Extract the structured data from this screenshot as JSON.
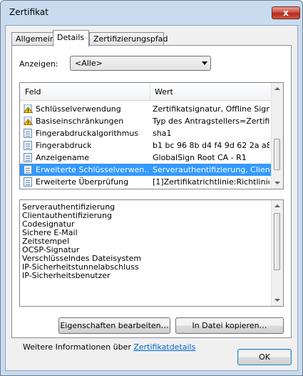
{
  "window": {
    "title": "Zertifikat",
    "close_glyph": "x"
  },
  "tabs": [
    {
      "label": "Allgemein",
      "active": false
    },
    {
      "label": "Details",
      "active": true
    },
    {
      "label": "Zertifizierungspfad",
      "active": false
    }
  ],
  "show": {
    "label": "Anzeigen:",
    "value": "<Alle>"
  },
  "fields_list": {
    "columns": {
      "field": "Feld",
      "value": "Wert"
    },
    "rows": [
      {
        "icon": "warning-certificate-icon",
        "field": "Schlüsselverwendung",
        "value": "Zertifikatsignatur, Offline Signi…"
      },
      {
        "icon": "warning-certificate-icon",
        "field": "Basiseinschränkungen",
        "value": "Typ des Antragstellers=Zertifi…"
      },
      {
        "icon": "certificate-field-icon",
        "field": "Fingerabdruckalgorithmus",
        "value": "sha1"
      },
      {
        "icon": "certificate-field-icon",
        "field": "Fingerabdruck",
        "value": "b1 bc 96 8b d4 f4 9d 62 2a a8 …"
      },
      {
        "icon": "certificate-field-icon",
        "field": "Anzeigename",
        "value": "GlobalSign Root CA - R1"
      },
      {
        "icon": "certificate-field-icon",
        "field": "Erweiterte Schlüsselverwen…",
        "value": "Serverauthentifizierung, Client…",
        "selected": true
      },
      {
        "icon": "certificate-field-icon",
        "field": "Erweiterte Überprüfung",
        "value": "[1]Zertifikatrichtlinie:Richtlinie…"
      }
    ]
  },
  "detail_text": {
    "lines": [
      "Serverauthentifizierung",
      "Clientauthentifizierung",
      "Codesignatur",
      "Sichere E-Mail",
      "Zeitstempel",
      "OCSP-Signatur",
      "Verschlüsselndes Dateisystem",
      "IP-Sicherheitstunnelabschluss",
      "IP-Sicherheitsbenutzer"
    ]
  },
  "buttons": {
    "edit_properties": "Eigenschaften bearbeiten…",
    "copy_to_file": "In Datei kopieren…",
    "ok": "OK"
  },
  "info": {
    "text": "Weitere Informationen über ",
    "link": "Zertifikatdetails"
  },
  "colors": {
    "selection": "#3399ff",
    "link": "#0066cc",
    "frame": "#c9dcef"
  }
}
